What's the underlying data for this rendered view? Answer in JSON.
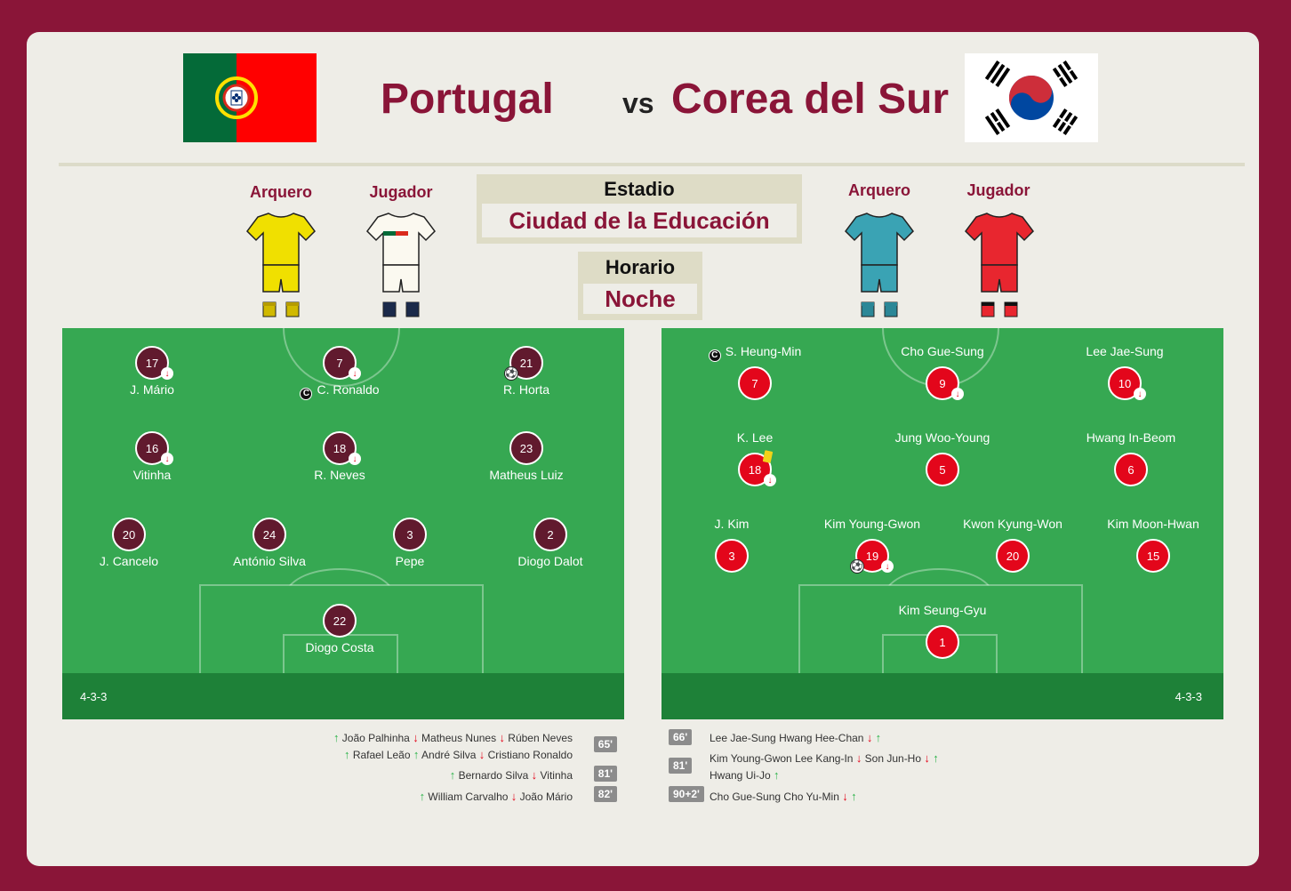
{
  "home": {
    "name": "Portugal",
    "goalkeeper_label": "Arquero",
    "player_label": "Jugador",
    "formation": "4-3-3",
    "color": "#611a2e",
    "players": [
      {
        "number": "17",
        "name": "J. Mário",
        "subbed": true
      },
      {
        "number": "7",
        "name": "C. Ronaldo",
        "subbed": true,
        "captain": true
      },
      {
        "number": "21",
        "name": "R. Horta",
        "goal": true
      },
      {
        "number": "16",
        "name": "Vitinha",
        "subbed": true
      },
      {
        "number": "18",
        "name": "R. Neves",
        "subbed": true
      },
      {
        "number": "23",
        "name": "Matheus Luiz"
      },
      {
        "number": "20",
        "name": "J. Cancelo"
      },
      {
        "number": "24",
        "name": "António Silva"
      },
      {
        "number": "3",
        "name": "Pepe"
      },
      {
        "number": "2",
        "name": "Diogo Dalot"
      },
      {
        "number": "22",
        "name": "Diogo Costa"
      }
    ],
    "substitutions": [
      {
        "minute": "65'",
        "rows": [
          [
            {
              "dir": "up",
              "name": "João Palhinha"
            },
            {
              "dir": "down",
              "name": "Matheus Nunes"
            },
            {
              "dir": "down",
              "name": "Rúben Neves"
            }
          ],
          [
            {
              "dir": "up",
              "name": "Rafael Leão"
            },
            {
              "dir": "up",
              "name": "André Silva"
            },
            {
              "dir": "down",
              "name": "Cristiano Ronaldo"
            }
          ]
        ]
      },
      {
        "minute": "81'",
        "rows": [
          [
            {
              "dir": "up",
              "name": "Bernardo Silva"
            },
            {
              "dir": "down",
              "name": "Vitinha"
            }
          ]
        ]
      },
      {
        "minute": "82'",
        "rows": [
          [
            {
              "dir": "up",
              "name": "William Carvalho"
            },
            {
              "dir": "down",
              "name": "João Mário"
            }
          ]
        ]
      }
    ]
  },
  "vs_label": "vs",
  "away": {
    "name": "Corea del Sur",
    "goalkeeper_label": "Arquero",
    "player_label": "Jugador",
    "formation": "4-3-3",
    "color": "#e3061b",
    "players": [
      {
        "number": "7",
        "name": "S. Heung-Min",
        "captain": true
      },
      {
        "number": "9",
        "name": "Cho Gue-Sung",
        "subbed": true
      },
      {
        "number": "10",
        "name": "Lee Jae-Sung",
        "subbed": true
      },
      {
        "number": "18",
        "name": "K. Lee",
        "subbed": true,
        "yellow": true
      },
      {
        "number": "5",
        "name": "Jung Woo-Young"
      },
      {
        "number": "6",
        "name": "Hwang In-Beom"
      },
      {
        "number": "3",
        "name": "J. Kim"
      },
      {
        "number": "19",
        "name": "Kim Young-Gwon",
        "subbed": true,
        "goal": true
      },
      {
        "number": "20",
        "name": "Kwon Kyung-Won"
      },
      {
        "number": "15",
        "name": "Kim Moon-Hwan"
      },
      {
        "number": "1",
        "name": "Kim Seung-Gyu"
      }
    ],
    "substitutions": [
      {
        "minute": "66'",
        "rows": [
          [
            {
              "dir": "none",
              "name": "Lee Jae-Sung"
            },
            {
              "dir": "down",
              "name": "Hwang Hee-Chan"
            },
            {
              "dir": "up",
              "name": ""
            }
          ]
        ]
      },
      {
        "minute": "81'",
        "rows": [
          [
            {
              "dir": "none",
              "name": "Kim Young-Gwon"
            },
            {
              "dir": "down",
              "name": "Lee Kang-In"
            },
            {
              "dir": "down",
              "name": "Son Jun-Ho"
            },
            {
              "dir": "up",
              "name": ""
            }
          ],
          [
            {
              "dir": "none",
              "name": "Hwang Ui-Jo"
            },
            {
              "dir": "up",
              "name": ""
            }
          ]
        ]
      },
      {
        "minute": "90+2'",
        "rows": [
          [
            {
              "dir": "none",
              "name": "Cho Gue-Sung"
            },
            {
              "dir": "down",
              "name": "Cho Yu-Min"
            },
            {
              "dir": "up",
              "name": ""
            }
          ]
        ]
      }
    ]
  },
  "stadium": {
    "label": "Estadio",
    "value": "Ciudad de la Educación"
  },
  "schedule": {
    "label": "Horario",
    "value": "Noche"
  },
  "kits": {
    "home_gk": "#f0e000",
    "home_player": "#fbf9f0",
    "away_gk": "#3aa3b4",
    "away_player": "#e8262f"
  }
}
